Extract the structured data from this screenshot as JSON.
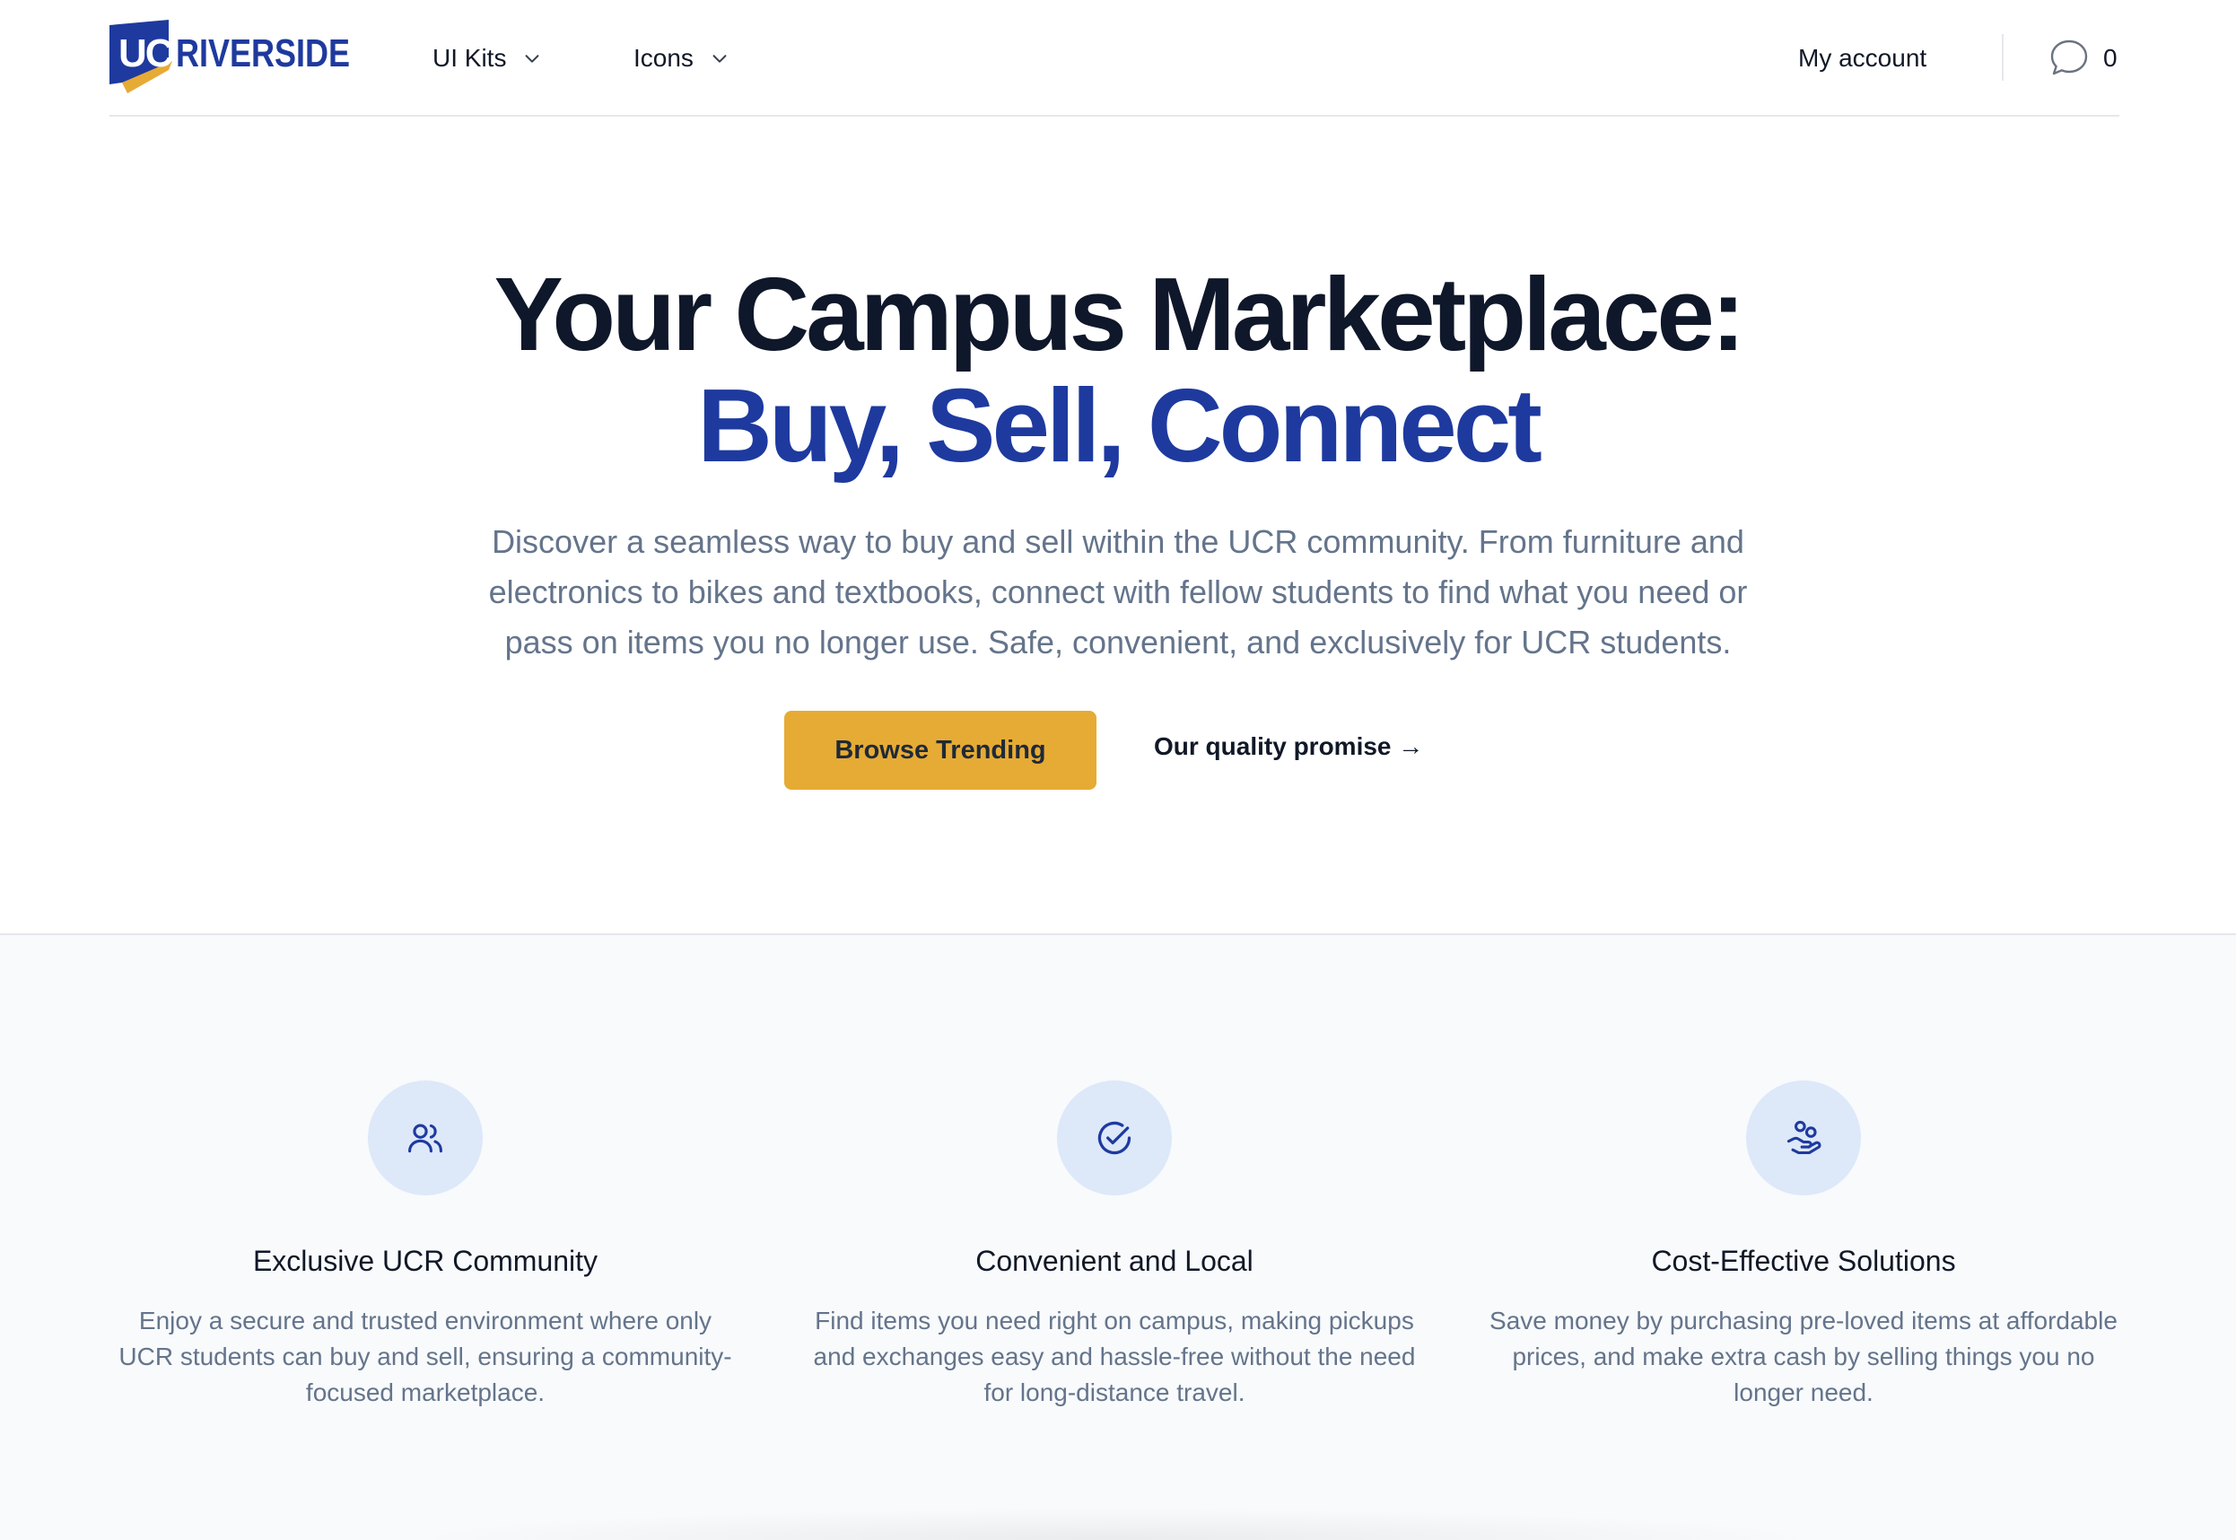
{
  "header": {
    "logo_text": "UC RIVERSIDE",
    "nav": [
      {
        "label": "UI Kits",
        "icon": "chevron-down-icon"
      },
      {
        "label": "Icons",
        "icon": "chevron-down-icon"
      }
    ],
    "account_label": "My account",
    "message_count": "0"
  },
  "hero": {
    "title_line1": "Your Campus Marketplace:",
    "title_line2": "Buy, Sell, Connect",
    "subtitle": "Discover a seamless way to buy and sell within the UCR community. From furniture and electronics to bikes and textbooks, connect with fellow students to find what you need or pass on items you no longer use. Safe, convenient, and exclusively for UCR students.",
    "primary_button": "Browse Trending",
    "secondary_link": "Our quality promise →"
  },
  "features": [
    {
      "icon": "users-icon",
      "title": "Exclusive UCR Community",
      "text": "Enjoy a secure and trusted environment where only UCR students can buy and sell, ensuring a community-focused marketplace."
    },
    {
      "icon": "check-circle-icon",
      "title": "Convenient and Local",
      "text": "Find items you need right on campus, making pickups and exchanges easy and hassle-free without the need for long-distance travel."
    },
    {
      "icon": "hand-coins-icon",
      "title": "Cost-Effective Solutions",
      "text": "Save money by purchasing pre-loved items at affordable prices, and make extra cash by selling things you no longer need."
    }
  ],
  "colors": {
    "brand_blue": "#1e3a9f",
    "cta_gold": "#e6ab35",
    "muted_text": "#64748b",
    "badge_bg": "#dde8f9"
  }
}
